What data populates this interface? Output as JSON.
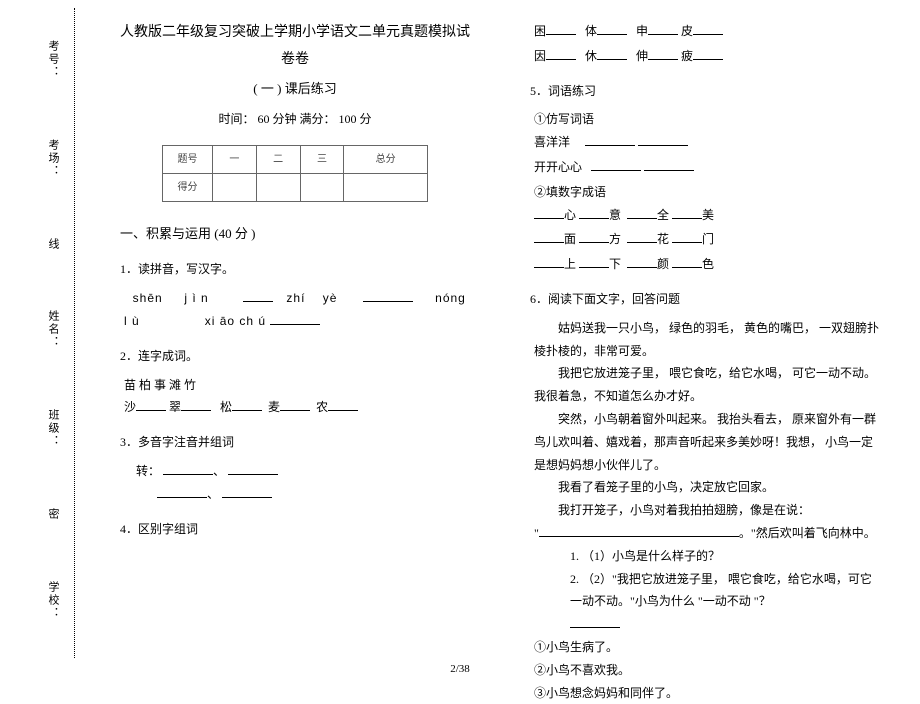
{
  "margin": {
    "kaohao": "考号：",
    "kaochang": "考场：",
    "xian": "线",
    "xingming": "姓名：",
    "banji": "班级：",
    "mi": "密",
    "xuexiao": "学校："
  },
  "header": {
    "title": "人教版二年级复习突破上学期小学语文二单元真题模拟试卷卷",
    "subtitle": "( 一 ) 课后练习",
    "timing": "时间：  60 分钟   满分：  100 分"
  },
  "scoreTable": {
    "rowLabels": [
      "题号",
      "得分"
    ],
    "cols": [
      "一",
      "二",
      "三",
      "总分"
    ]
  },
  "section1": {
    "heading": "一、积累与运用  (40 分 )",
    "q1": {
      "label": "1．读拼音，写汉字。",
      "line1a": "shēn",
      "line1b": "j ì n",
      "line1c": "zhí",
      "line1d": "yè",
      "line1e": "nóng",
      "line2a": "l ù",
      "line2b": "xi āo ch ú"
    },
    "q2": {
      "label": "2．连字成词。",
      "row1": "苗         柏         事         滩         竹",
      "row2p": [
        "沙",
        "翠",
        "松",
        "麦",
        "农"
      ]
    },
    "q3": {
      "label": "3．多音字注音并组词",
      "char": "转："
    },
    "q4": {
      "label": "4．区别字组词",
      "pairs": [
        [
          "困",
          "体",
          "申",
          "皮"
        ],
        [
          "因",
          "休",
          "伸",
          "疲"
        ]
      ]
    },
    "q5": {
      "label": "5．词语练习",
      "sub1": "①仿写词语",
      "xi": "喜洋洋",
      "kai": "开开心心",
      "sub2": "②填数字成语",
      "idiom_rows": [
        [
          "心",
          "意",
          "全",
          "美"
        ],
        [
          "面",
          "方",
          "花",
          "门"
        ],
        [
          "上",
          "下",
          "颜",
          "色"
        ]
      ]
    },
    "q6": {
      "label": "6．阅读下面文字，回答问题",
      "p1": "姑妈送我一只小鸟，  绿色的羽毛，  黄色的嘴巴，  一双翅膀扑棱扑棱的，非常可爱。",
      "p2": "我把它放进笼子里，  喂它食吃，给它水喝，  可它一动不动。我很着急，不知道怎么办才好。",
      "p3": "突然，小鸟朝着窗外叫起来。  我抬头看去，  原来窗外有一群鸟儿欢叫着、嬉戏着，那声音听起来多美妙呀！我想，  小鸟一定是想妈妈想小伙伴儿了。",
      "p4a": "我看了看笼子里的小鸟，决定放它回家。",
      "p4b_pre": "我打开笼子，小鸟对着我拍拍翅膀，像是在说：",
      "p4b_post": "。\"然后欢叫着飞向林中。",
      "sub_q1": "1.  （1）小鸟是什么样子的？",
      "sub_q2": "2.  （2）\"我把它放进笼子里，  喂它食吃，给它水喝，可它一动不动。\"小鸟为什么 \"一动不动 \"？",
      "opt1": "①小鸟生病了。",
      "opt2": "②小鸟不喜欢我。",
      "opt3": "③小鸟想念妈妈和同伴了。"
    }
  },
  "footer": "2/38"
}
